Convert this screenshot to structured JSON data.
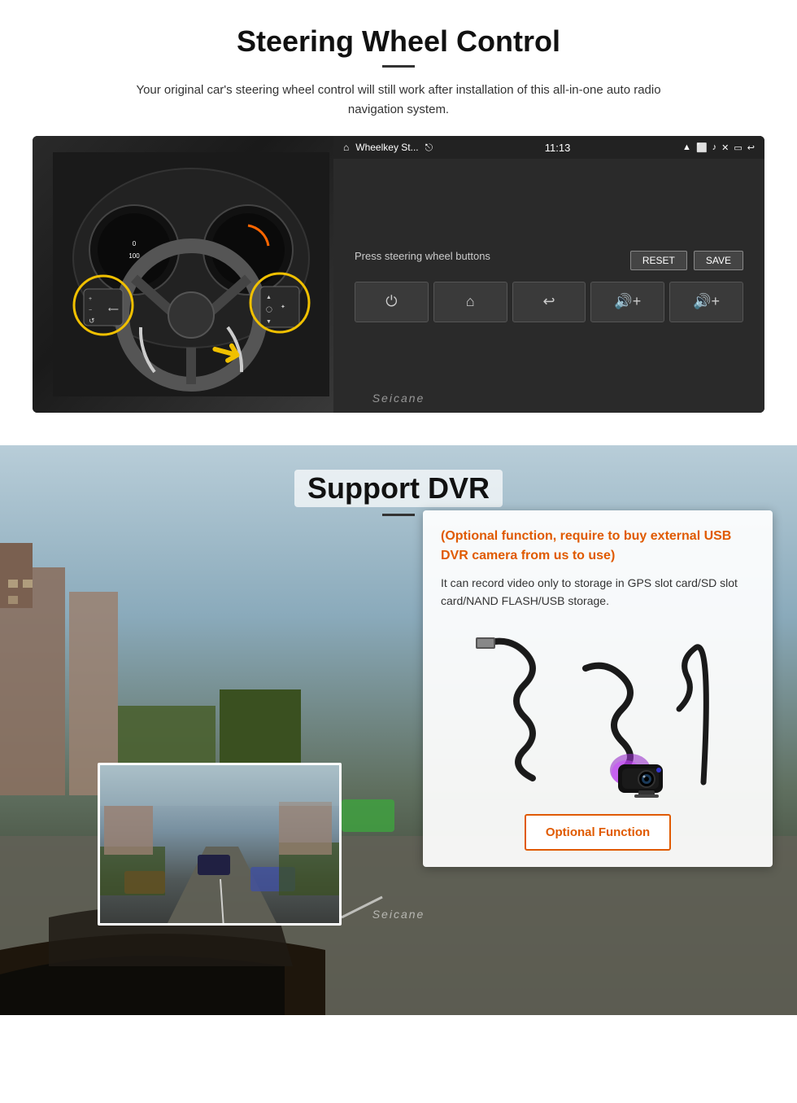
{
  "steering_section": {
    "title": "Steering Wheel Control",
    "subtitle": "Your original car's steering wheel control will still work after installation of this all-in-one auto radio navigation system.",
    "android_screen": {
      "status_text": "Wheelkey St...",
      "time": "11:13",
      "label": "Press steering wheel buttons",
      "reset_btn": "RESET",
      "save_btn": "SAVE",
      "buttons": [
        "⏻",
        "🏠",
        "↩",
        "🔊+",
        "🔊+"
      ]
    },
    "watermark": "Seicane"
  },
  "dvr_section": {
    "title": "Support DVR",
    "optional_text": "(Optional function, require to buy external USB DVR camera from us to use)",
    "description": "It can record video only to storage in GPS slot card/SD slot card/NAND FLASH/USB storage.",
    "optional_function_label": "Optional Function",
    "watermark": "Seicane"
  }
}
